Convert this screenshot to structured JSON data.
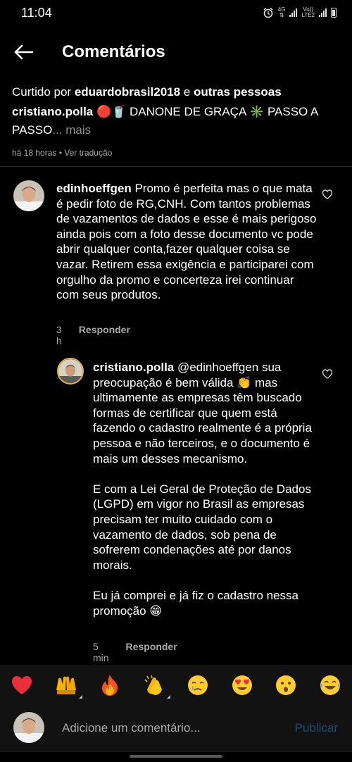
{
  "status_bar": {
    "time": "11:04",
    "net_top": "4G",
    "net_mid": "Vo))",
    "net_bot": "LTE2"
  },
  "header": {
    "title": "Comentários"
  },
  "post": {
    "liked_prefix": "Curtido por ",
    "liked_user": "eduardobrasil2018",
    "liked_mid": " e ",
    "liked_others": "outras pessoas",
    "author": "cristiano.polla",
    "caption": " 🔴🥤 DANONE DE GRAÇA ✳️ PASSO A PASSO",
    "more": "... mais",
    "time": "há 18 horas",
    "sep": " • ",
    "translate": "Ver tradução"
  },
  "comments": [
    {
      "user": "edinhoeffgen",
      "text": " Promo é perfeita mas o que mata é pedir foto de RG,CNH. Com tantos problemas de vazamentos de dados e esse é mais perigoso ainda pois com a foto desse documento vc pode abrir qualquer conta,fazer qualquer coisa se vazar. Retirem essa exigência e participarei com orgulho da promo e concerteza irei continuar com seus produtos.",
      "time": "3 h",
      "reply": "Responder"
    },
    {
      "user": "cristiano.polla",
      "mention": " @edinhoeffgen",
      "p1": " sua preocupação é bem válida 👏 mas ultimamente as empresas têm buscado formas de certificar que quem está fazendo o cadastro realmente é a própria pessoa e não terceiros, e o documento é mais um desses mecanismo.",
      "p2": "E com a Lei Geral de Proteção de Dados (LGPD) em vigor no Brasil as empresas precisam ter muito cuidado com o vazamento de dados, sob pena de sofrerem condenações até por danos morais.",
      "p3": "Eu já comprei e já fiz o cadastro nessa promoção 😁",
      "time": "5 min",
      "reply": "Responder"
    }
  ],
  "emoji_bar": [
    "❤️",
    "🙌",
    "🔥",
    "👏",
    "😢",
    "😍",
    "😮",
    "😂"
  ],
  "compose": {
    "placeholder": "Adicione um comentário...",
    "publish": "Publicar"
  },
  "colors": {
    "background": "#000000",
    "muted": "#a8a8a8",
    "publish": "#1a4d7a",
    "bar": "#121212"
  }
}
